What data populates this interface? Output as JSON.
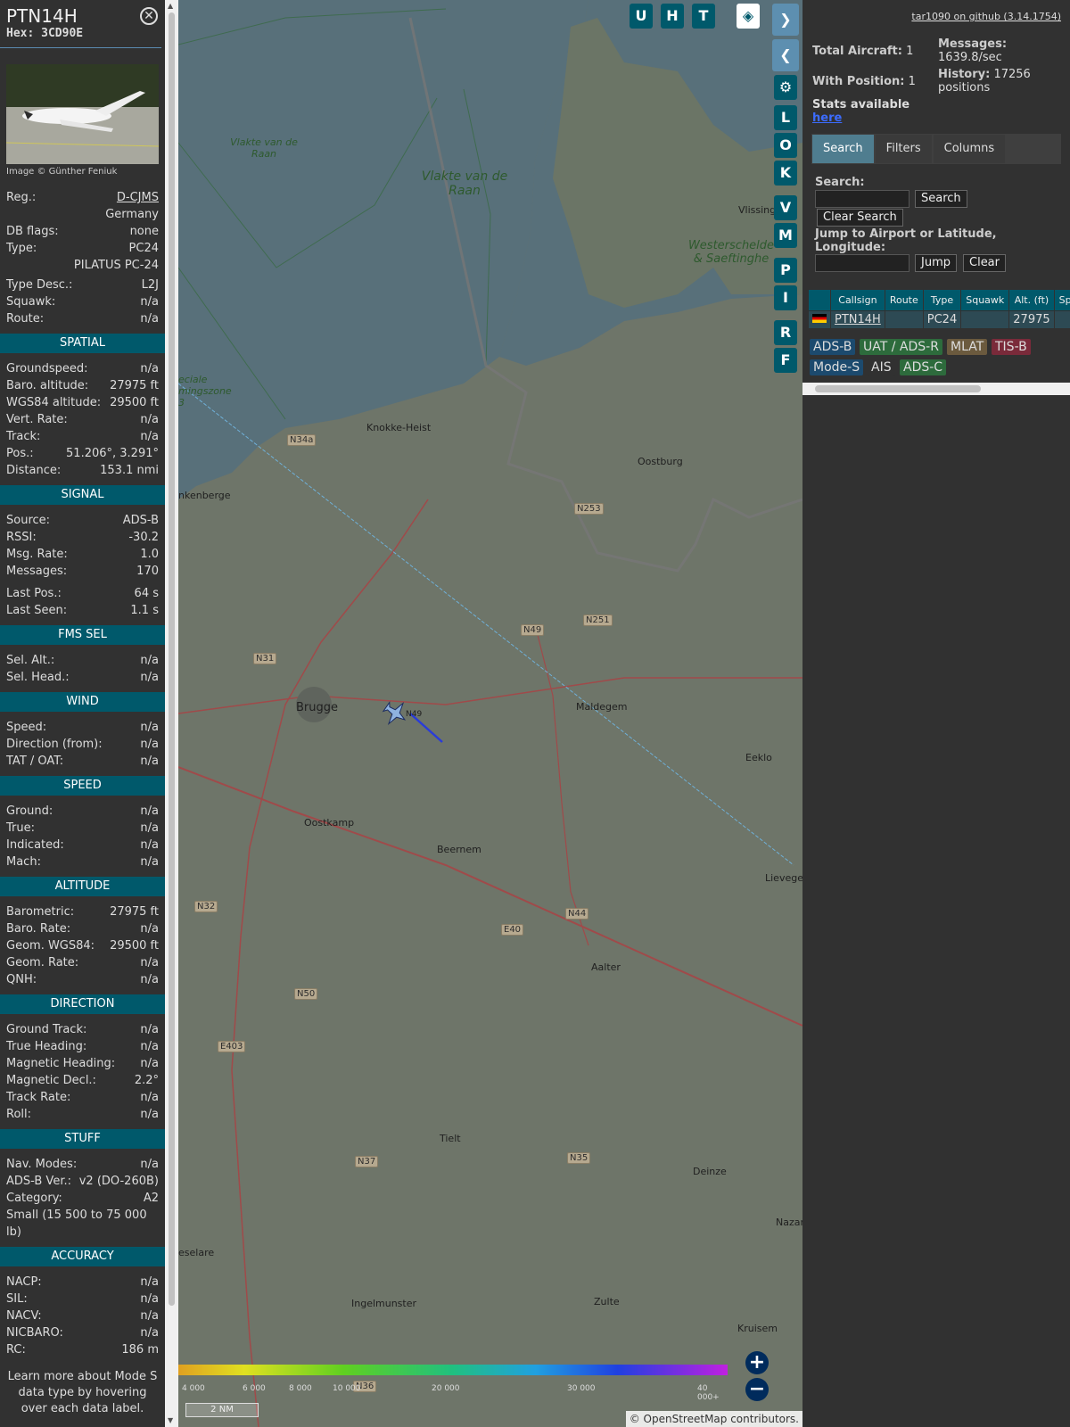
{
  "aircraft": {
    "callsign": "PTN14H",
    "hex_label": "Hex:",
    "hex": "3CD90E",
    "image_credit": "Image © Günther Feniuk",
    "reg_label": "Reg.:",
    "reg": "D-CJMS",
    "country": "Germany",
    "dbflags_label": "DB flags:",
    "dbflags": "none",
    "type_label": "Type:",
    "type": "PC24",
    "type_full": "PILATUS PC-24",
    "typedesc_label": "Type Desc.:",
    "typedesc": "L2J",
    "squawk_label": "Squawk:",
    "squawk": "n/a",
    "route_label": "Route:",
    "route": "n/a"
  },
  "sections": [
    {
      "title": "SPATIAL",
      "rows": [
        {
          "k": "Groundspeed:",
          "v": "n/a"
        },
        {
          "k": "Baro. altitude:",
          "v": "27975 ft"
        },
        {
          "k": "WGS84 altitude:",
          "v": "29500 ft"
        },
        {
          "k": "Vert. Rate:",
          "v": "n/a"
        },
        {
          "k": "Track:",
          "v": "n/a"
        },
        {
          "k": "Pos.:",
          "v": "51.206°, 3.291°"
        },
        {
          "k": "Distance:",
          "v": "153.1 nmi"
        }
      ]
    },
    {
      "title": "SIGNAL",
      "rows": [
        {
          "k": "Source:",
          "v": "ADS-B"
        },
        {
          "k": "RSSI:",
          "v": "-30.2"
        },
        {
          "k": "Msg. Rate:",
          "v": "1.0"
        },
        {
          "k": "Messages:",
          "v": "170"
        },
        {
          "k": "",
          "v": ""
        },
        {
          "k": "Last Pos.:",
          "v": "64 s"
        },
        {
          "k": "Last Seen:",
          "v": "1.1 s"
        }
      ]
    },
    {
      "title": "FMS SEL",
      "rows": [
        {
          "k": "Sel. Alt.:",
          "v": "n/a"
        },
        {
          "k": "Sel. Head.:",
          "v": "n/a"
        }
      ]
    },
    {
      "title": "WIND",
      "rows": [
        {
          "k": "Speed:",
          "v": "n/a"
        },
        {
          "k": "Direction (from):",
          "v": "n/a"
        },
        {
          "k": "TAT / OAT:",
          "v": "n/a"
        }
      ]
    },
    {
      "title": "SPEED",
      "rows": [
        {
          "k": "Ground:",
          "v": "n/a"
        },
        {
          "k": "True:",
          "v": "n/a"
        },
        {
          "k": "Indicated:",
          "v": "n/a"
        },
        {
          "k": "Mach:",
          "v": "n/a"
        }
      ]
    },
    {
      "title": "ALTITUDE",
      "rows": [
        {
          "k": "Barometric:",
          "v": "27975 ft"
        },
        {
          "k": "Baro. Rate:",
          "v": "n/a"
        },
        {
          "k": "Geom. WGS84:",
          "v": "29500 ft"
        },
        {
          "k": "Geom. Rate:",
          "v": "n/a"
        },
        {
          "k": "QNH:",
          "v": "n/a"
        }
      ]
    },
    {
      "title": "DIRECTION",
      "rows": [
        {
          "k": "Ground Track:",
          "v": "n/a"
        },
        {
          "k": "True Heading:",
          "v": "n/a"
        },
        {
          "k": "Magnetic Heading:",
          "v": "n/a"
        },
        {
          "k": "Magnetic Decl.:",
          "v": "2.2°"
        },
        {
          "k": "Track Rate:",
          "v": "n/a"
        },
        {
          "k": "Roll:",
          "v": "n/a"
        }
      ]
    },
    {
      "title": "STUFF",
      "rows": [
        {
          "k": "Nav. Modes:",
          "v": "n/a"
        },
        {
          "k": "ADS-B Ver.:",
          "v": "v2 (DO-260B)"
        },
        {
          "k": "Category:",
          "v": "A2"
        },
        {
          "k": "Small (15 500 to 75 000 lb)",
          "v": ""
        }
      ]
    },
    {
      "title": "ACCURACY",
      "rows": [
        {
          "k": "NACP:",
          "v": "n/a"
        },
        {
          "k": "SIL:",
          "v": "n/a"
        },
        {
          "k": "NACV:",
          "v": "n/a"
        },
        {
          "k": "NICBARO:",
          "v": "n/a"
        },
        {
          "k": "RC:",
          "v": "186 m"
        }
      ]
    }
  ],
  "learn_more": "Learn more about Mode S data type by hovering over each data label.",
  "map": {
    "buttons_top": [
      "U",
      "H",
      "T"
    ],
    "buttons_side": [
      "L",
      "O",
      "K",
      "V",
      "M",
      "P",
      "I",
      "R",
      "F"
    ],
    "places": [
      "Knokke-Heist",
      "Oostburg",
      "Brugge",
      "Maldegem",
      "Eeklo",
      "Oostkamp",
      "Beernem",
      "Lievegem",
      "Aalter",
      "Tielt",
      "Deinze",
      "Ingelmunster",
      "Zulte",
      "Kruisem",
      "Vlissingen",
      "nkenberge",
      "eselare",
      "Nazar"
    ],
    "water": [
      "Vlakte van de Raan",
      "Vlakte van de Raan",
      "Westerschelde & Saeftinghe",
      "eciale mingszone 3"
    ],
    "roads": [
      "N34a",
      "N253",
      "N49",
      "N251",
      "N31",
      "N32",
      "E40",
      "N44",
      "N50",
      "E403",
      "N37",
      "N35",
      "N36"
    ],
    "altitude_ticks": [
      "4 000",
      "6 000",
      "8 000",
      "10 000",
      "20 000",
      "30 000",
      "40 000+"
    ],
    "scale": "2 NM",
    "attribution": "© OpenStreetMap contributors.",
    "aircraft_label": "N49"
  },
  "panel": {
    "github": "tar1090 on github (3.14.1754)",
    "total_aircraft_label": "Total Aircraft:",
    "total_aircraft": "1",
    "with_position_label": "With Position:",
    "with_position": "1",
    "stats_label": "Stats available",
    "stats_link": "here",
    "messages_label": "Messages:",
    "messages": "1639.8/sec",
    "history_label": "History:",
    "history": "17256 positions",
    "tabs": [
      "Search",
      "Filters",
      "Columns"
    ],
    "search_label": "Search:",
    "search_btn": "Search",
    "clear_search_btn": "Clear Search",
    "jump_label": "Jump to Airport or Latitude, Longitude:",
    "jump_btn": "Jump",
    "clear_btn": "Clear",
    "columns": [
      "",
      "Callsign",
      "Route",
      "Type",
      "Squawk",
      "Alt. (ft)",
      "Spd."
    ],
    "rows": [
      {
        "callsign": "PTN14H",
        "route": "",
        "type": "PC24",
        "squawk": "",
        "alt": "27975",
        "spd": ""
      }
    ],
    "legend": [
      {
        "label": "ADS-B",
        "color": "#1c4a6e"
      },
      {
        "label": "UAT / ADS-R",
        "color": "#2d6b3c"
      },
      {
        "label": "MLAT",
        "color": "#6b5a3e"
      },
      {
        "label": "TIS-B",
        "color": "#7a2a3a"
      },
      {
        "label": "Mode-S",
        "color": "#1c4a6e"
      },
      {
        "label": "AIS",
        "color": "#313131"
      },
      {
        "label": "ADS-C",
        "color": "#2d6b3c"
      }
    ]
  }
}
